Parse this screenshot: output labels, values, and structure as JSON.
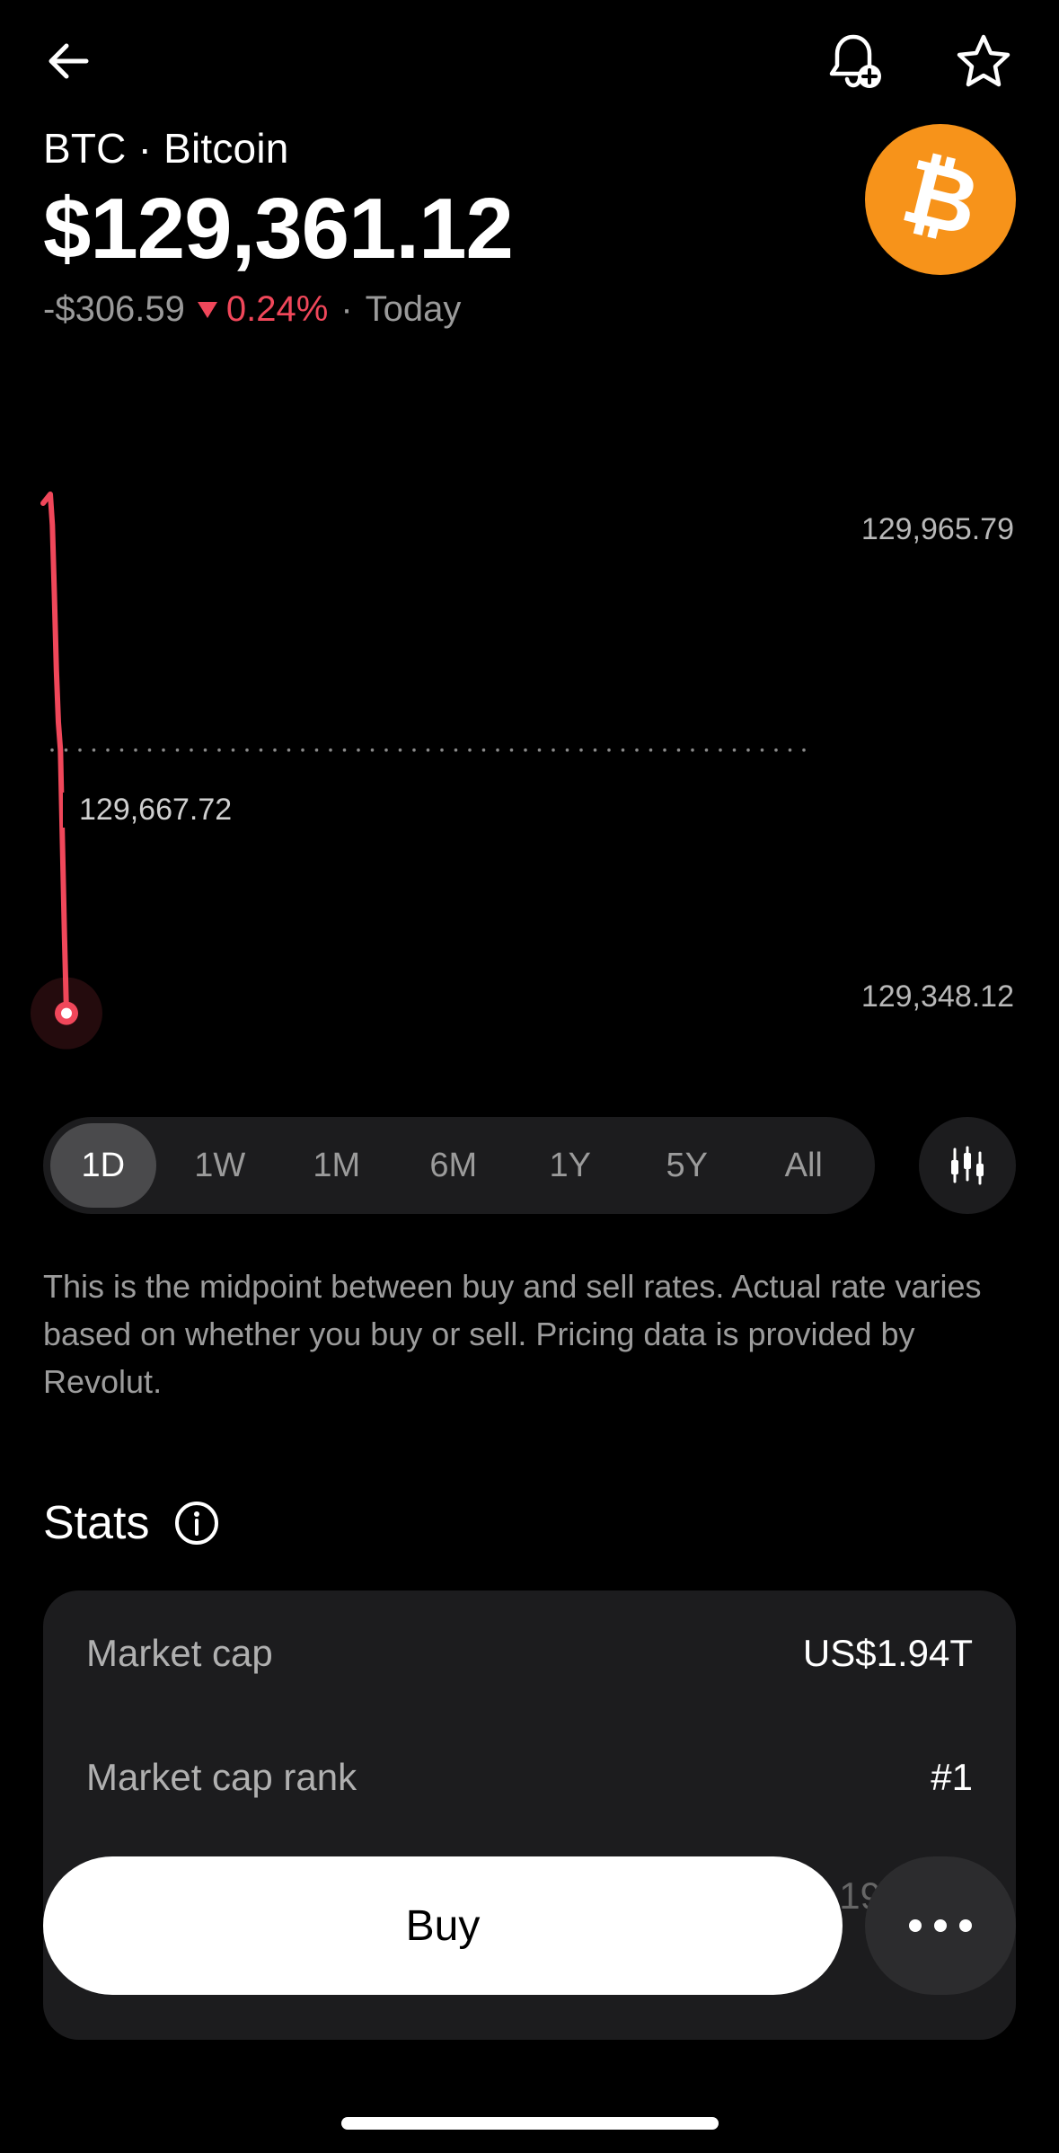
{
  "header": {
    "ticker": "BTC · Bitcoin",
    "price": "$129,361.12",
    "change_abs": "-$306.59",
    "change_pct": "0.24%",
    "change_sep": "·",
    "change_period": "Today",
    "change_color": "#f0475a"
  },
  "coin": {
    "icon": "bitcoin-logo-icon",
    "glyph": "₿",
    "color": "#F7931A"
  },
  "chart_data": {
    "type": "line",
    "y_high_label": "129,965.79",
    "y_low_label": "129,348.12",
    "reference_label": "129,667.72",
    "series_color": "#f0475a",
    "ylim": [
      129348.12,
      129965.79
    ],
    "reference_value": 129667.72,
    "series": [
      {
        "values": [
          129965.79,
          129930,
          129850,
          129760,
          129700,
          129667.72,
          129560,
          129450,
          129361.12
        ]
      }
    ]
  },
  "range": {
    "tabs": [
      "1D",
      "1W",
      "1M",
      "6M",
      "1Y",
      "5Y",
      "All"
    ],
    "active": "1D"
  },
  "disclaimer": "This is the midpoint between buy and sell rates. Actual rate varies based on whether you buy or sell. Pricing data is provided by Revolut.",
  "stats": {
    "title": "Stats",
    "rows": [
      {
        "label": "Market cap",
        "value": "US$1.94T"
      },
      {
        "label": "Market cap rank",
        "value": "#1"
      }
    ],
    "partial_value": "19"
  },
  "actions": {
    "buy_label": "Buy"
  }
}
